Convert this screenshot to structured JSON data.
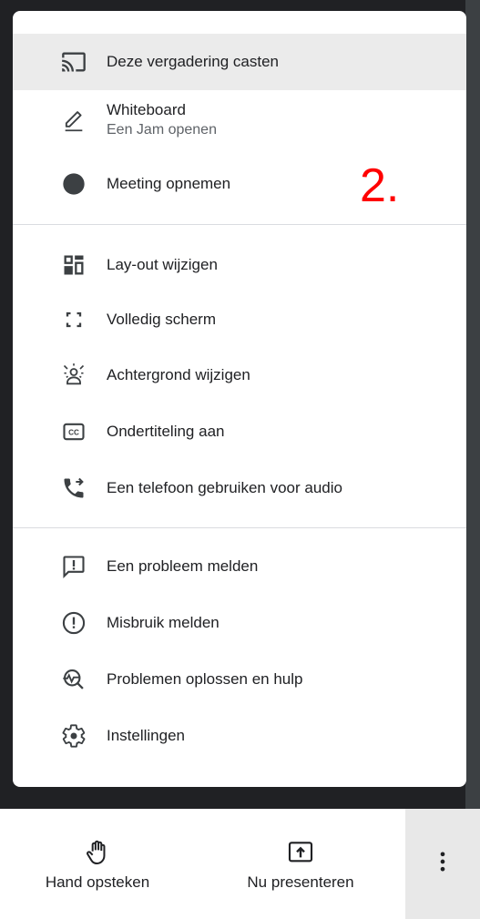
{
  "menu": {
    "items": [
      {
        "label": "Deze vergadering casten",
        "icon": "cast-icon"
      },
      {
        "label": "Whiteboard",
        "sublabel": "Een Jam openen",
        "icon": "pen-icon"
      },
      {
        "label": "Meeting opnemen",
        "icon": "record-icon"
      },
      {
        "label": "Lay-out wijzigen",
        "icon": "layout-icon"
      },
      {
        "label": "Volledig scherm",
        "icon": "fullscreen-icon"
      },
      {
        "label": "Achtergrond wijzigen",
        "icon": "background-icon"
      },
      {
        "label": "Ondertiteling aan",
        "icon": "captions-icon"
      },
      {
        "label": "Een telefoon gebruiken voor audio",
        "icon": "phone-forward-icon"
      },
      {
        "label": "Een probleem melden",
        "icon": "feedback-icon"
      },
      {
        "label": "Misbruik melden",
        "icon": "report-icon"
      },
      {
        "label": "Problemen oplossen en hulp",
        "icon": "troubleshoot-icon"
      },
      {
        "label": "Instellingen",
        "icon": "gear-icon"
      }
    ]
  },
  "annotation": {
    "text": "2.",
    "color": "#ff0000"
  },
  "bottombar": {
    "raise_hand": {
      "label": "Hand opsteken",
      "icon": "hand-icon"
    },
    "present": {
      "label": "Nu presenteren",
      "icon": "present-icon"
    },
    "more": {
      "icon": "more-vert-icon"
    }
  },
  "colors": {
    "backdrop": "#202124",
    "highlight": "#ebebeb",
    "text": "#202124",
    "secondary": "#5f6368"
  }
}
